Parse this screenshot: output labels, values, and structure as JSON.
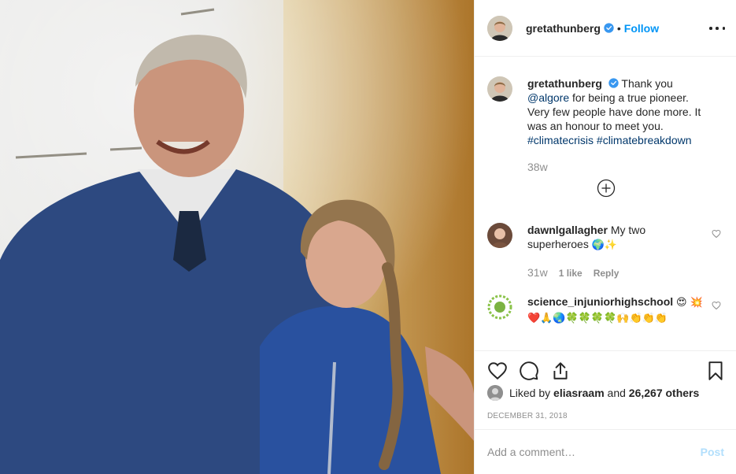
{
  "post": {
    "username": "gretathunberg",
    "separator": "•",
    "follow_label": "Follow",
    "caption": {
      "username": "gretathunberg",
      "text_1": "Thank you ",
      "mention": "@algore",
      "text_2": " for being a true pioneer. Very few people have done more. It was an honour to meet you. ",
      "hashtag_1": "#climatecrisis",
      "hashtag_2": "#climatebreakdown",
      "age": "38w"
    },
    "comments": [
      {
        "username": "dawnlgallagher",
        "text": "My two superheroes",
        "emoji": "🌍✨",
        "age": "31w",
        "likes": "1 like",
        "reply_label": "Reply"
      },
      {
        "username": "science_injuniorhighschool",
        "emoji_1": "😍",
        "emoji_2": "💥❤️🙏🌏🍀🍀🍀🍀🙌👏👏👏"
      }
    ],
    "liked_by_prefix": "Liked by ",
    "liked_by_user": "eliasraam",
    "liked_by_mid": " and ",
    "liked_by_count": "26,267 others",
    "date": "December 31, 2018",
    "add_comment_placeholder": "Add a comment…",
    "post_label": "Post"
  },
  "colors": {
    "accent": "#0095f6",
    "link": "#00376b",
    "muted": "#8e8e8e",
    "post_disabled": "#b2dffc"
  },
  "icons": {
    "more": "more-options-icon",
    "verified": "verified-badge-icon",
    "load_more": "load-more-comments-icon",
    "like": "heart-icon",
    "comment": "comment-icon",
    "share": "share-icon",
    "save": "bookmark-icon"
  }
}
